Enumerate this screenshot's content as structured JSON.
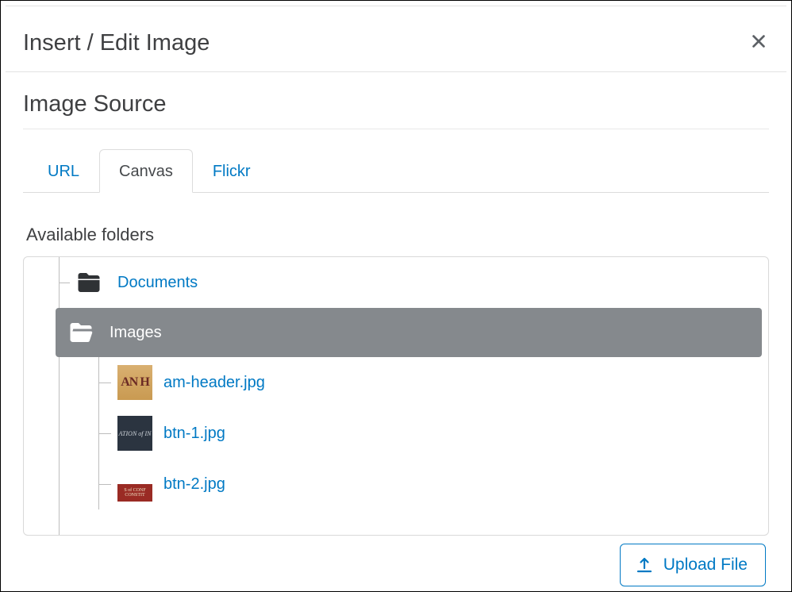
{
  "modal": {
    "title": "Insert / Edit Image"
  },
  "section": {
    "title": "Image Source"
  },
  "tabs": {
    "url": "URL",
    "canvas": "Canvas",
    "flickr": "Flickr"
  },
  "tree": {
    "heading": "Available folders",
    "folders": {
      "documents": "Documents",
      "images": "Images"
    },
    "files": [
      {
        "name": "am-header.jpg"
      },
      {
        "name": "btn-1.jpg"
      },
      {
        "name": "btn-2.jpg"
      }
    ]
  },
  "footer": {
    "upload_label": "Upload File"
  }
}
